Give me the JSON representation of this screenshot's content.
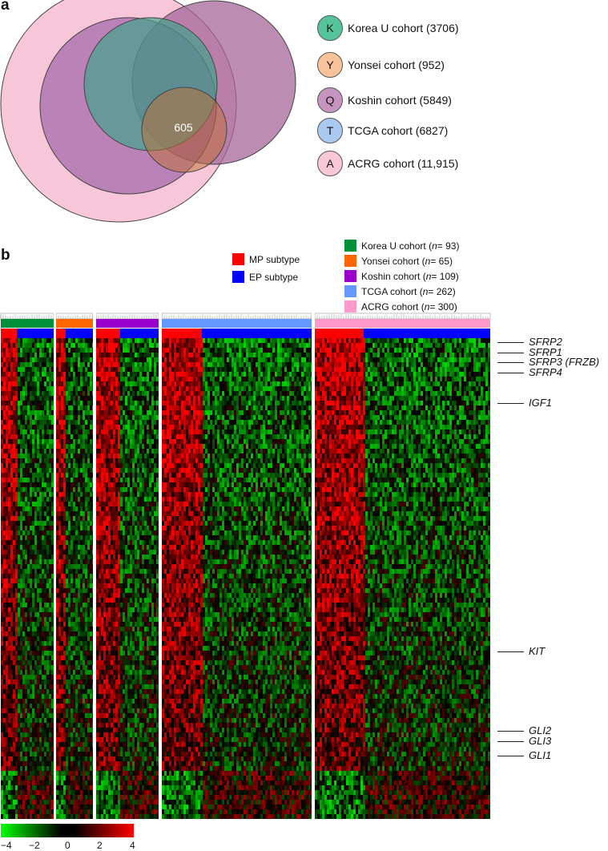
{
  "panel_a": {
    "letter": "a",
    "center_value": "605"
  },
  "panel_b": {
    "letter": "b"
  },
  "cohort_legend": [
    {
      "key": "K",
      "label": "Korea U cohort (3706)",
      "color": "#55c49b"
    },
    {
      "key": "Y",
      "label": "Yonsei cohort (952)",
      "color": "#f8c29a"
    },
    {
      "key": "Q",
      "label": "Koshin cohort (5849)",
      "color": "#c595c0"
    },
    {
      "key": "T",
      "label": "TCGA cohort (6827)",
      "color": "#a9c9f1"
    },
    {
      "key": "A",
      "label": "ACRG cohort (11,915)",
      "color": "#f9c8d6"
    }
  ],
  "subtype_legend": [
    {
      "label": "MP subtype",
      "color": "#ff0000"
    },
    {
      "label": "EP subtype",
      "color": "#0000ff"
    }
  ],
  "heatmap_cohort_legend": [
    {
      "name": "Korea U cohort",
      "n_prefix": "(",
      "n_var": "n",
      "n_suffix": " = 93)",
      "color": "#00913a"
    },
    {
      "name": "Yonsei cohort",
      "n_prefix": "(",
      "n_var": "n",
      "n_suffix": " = 65)",
      "color": "#ff6600"
    },
    {
      "name": "Koshin cohort",
      "n_prefix": "(",
      "n_var": "n",
      "n_suffix": " = 109)",
      "color": "#9a00cc"
    },
    {
      "name": "TCGA cohort",
      "n_prefix": "(",
      "n_var": "n",
      "n_suffix": " = 262)",
      "color": "#6699ff"
    },
    {
      "name": "ACRG cohort",
      "n_prefix": "(",
      "n_var": "n",
      "n_suffix": " = 300)",
      "color": "#ff99cc"
    }
  ],
  "genes": {
    "sfrp2": "SFRP2",
    "sfrp1": "SFRP1",
    "sfrp3": "SFRP3 (FRZB)",
    "sfrp4": "SFRP4",
    "igf1": "IGF1",
    "kit": "KIT",
    "gli2": "GLI2",
    "gli3": "GLI3",
    "gli1": "GLI1"
  },
  "colorbar": {
    "ticks": [
      "−4",
      "−2",
      "0",
      "2",
      "4"
    ],
    "low_color": "#00ff00",
    "mid_color": "#000000",
    "high_color": "#ff0000"
  },
  "chart_data": {
    "type": "heatmap",
    "venn_gene_counts": {
      "Korea U": 3706,
      "Yonsei": 952,
      "Koshin": 5849,
      "TCGA": 6827,
      "ACRG": 11915,
      "intersection": 605
    },
    "cohorts": [
      {
        "name": "Korea U cohort",
        "n": 93,
        "mp_fraction": 0.3
      },
      {
        "name": "Yonsei cohort",
        "n": 65,
        "mp_fraction": 0.26
      },
      {
        "name": "Koshin cohort",
        "n": 109,
        "mp_fraction": 0.38
      },
      {
        "name": "TCGA cohort",
        "n": 262,
        "mp_fraction": 0.27
      },
      {
        "name": "ACRG cohort",
        "n": 300,
        "mp_fraction": 0.28
      }
    ],
    "color_scale": [
      -4,
      4
    ]
  }
}
